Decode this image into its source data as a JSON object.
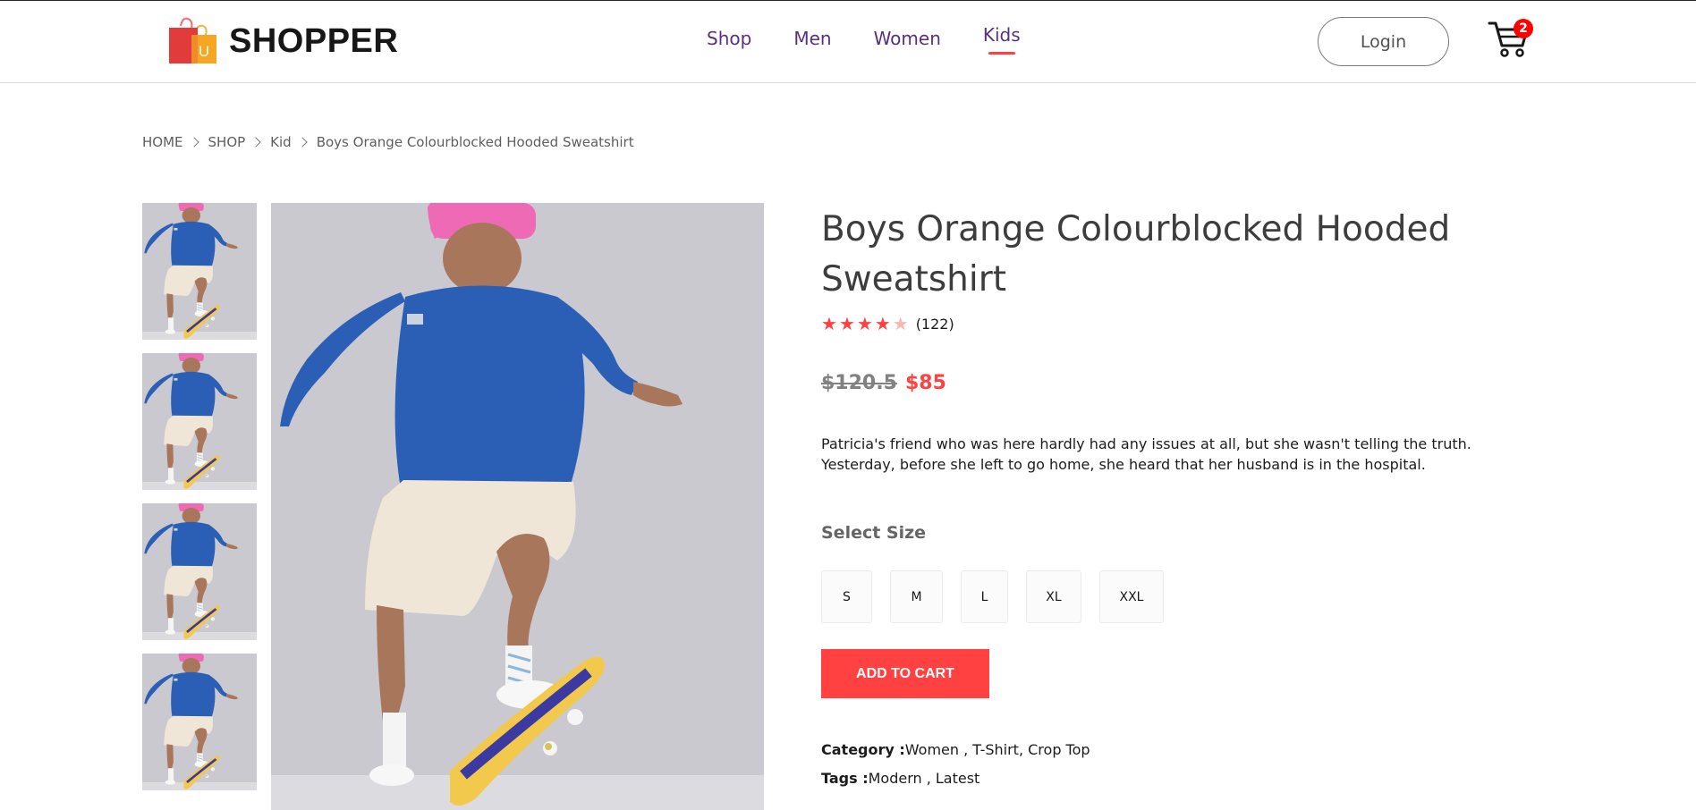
{
  "brand": {
    "name": "SHOPPER",
    "logo_icon": "shopping-bags-icon",
    "logo_letter": "U"
  },
  "nav": {
    "items": [
      {
        "label": "Shop",
        "active": false
      },
      {
        "label": "Men",
        "active": false
      },
      {
        "label": "Women",
        "active": false
      },
      {
        "label": "Kids",
        "active": true
      }
    ],
    "login_label": "Login",
    "cart_icon": "shopping-cart-icon",
    "cart_count": "2"
  },
  "breadcrumb": [
    "HOME",
    "SHOP",
    "Kid",
    "Boys Orange Colourblocked Hooded Sweatshirt"
  ],
  "gallery": {
    "thumbnail_count": 4,
    "main_image": "boy-on-skateboard-photo"
  },
  "product": {
    "title": "Boys Orange Colourblocked Hooded Sweatshirt",
    "rating": 4,
    "rating_max": 5,
    "review_count": "(122)",
    "old_price": "$120.5",
    "new_price": "$85",
    "description": "Patricia's friend who was here hardly had any issues at all, but she wasn't telling the truth. Yesterday, before she left to go home, she heard that her husband is in the hospital.",
    "size_label": "Select Size",
    "sizes": [
      "S",
      "M",
      "L",
      "XL",
      "XXL"
    ],
    "add_to_cart_label": "ADD TO CART",
    "category_label": "Category :",
    "category_value": "Women , T-Shirt, Crop Top",
    "tags_label": "Tags :",
    "tags_value": "Modern , Latest"
  },
  "colors": {
    "accent": "#ff4141",
    "nav_text": "#5a2f7e",
    "text": "#171717"
  }
}
